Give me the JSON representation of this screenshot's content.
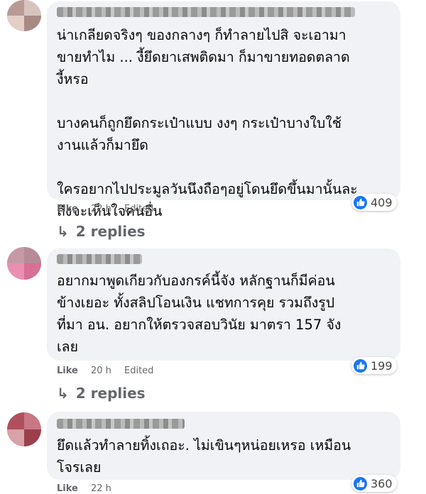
{
  "comments": [
    {
      "text": "น่าเกลียดจริงๆ ของกลางๆ ก็ทำลายไปสิ จะเอามา\nขายทำไม ... งี้ยึดยาเสพติดมา ก็มาขายทอดตลาด\nงี้หรอ\n\nบางคนก็ถูกยึดกระเป๋าแบบ งงๆ กระเป๋าบางใบใช้\nงานแล้วก็มายึด\n\nใครอยากไปประมูลวันนึงถือๆอยู่โดนยึดขึ้นมานั้นละ\nถึงจะเห็นใจคนอื่น",
      "like_label": "Like",
      "time": "22 h",
      "edited": "Edited",
      "reaction_count": "409",
      "replies_label": "2 replies"
    },
    {
      "text": "อยากมาพูดเกียวกับองกรค์นี้จัง หลักฐานก็มีค่อน\nข้างเยอะ ทั้งสลิปโอนเงิน แชทการคุย รวมถึงรูป\nที่มา อน. อยากให้ตรวจสอบวินัย มาตรา 157 จัง\nเลย",
      "like_label": "Like",
      "time": "20 h",
      "edited": "Edited",
      "reaction_count": "199",
      "replies_label": "2 replies"
    },
    {
      "text": "ยึดแล้วทำลายทิ้งเถอะ. ไม่เขินๆหน่อยเหรอ เหมือน\nโจรเลย",
      "like_label": "Like",
      "time": "22 h",
      "reaction_count": "360"
    }
  ],
  "icons": {
    "reaction": "like-thumb-icon",
    "replies": "reply-arrow-icon"
  },
  "colors": {
    "bubble": "#f0f2f5",
    "meta": "#65676b",
    "like_blue": "#1877f2",
    "text": "#050505"
  }
}
